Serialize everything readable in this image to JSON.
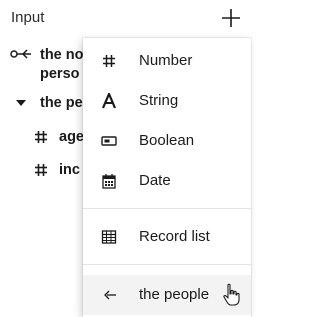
{
  "panel": {
    "title": "Input",
    "add_icon": "plus-icon"
  },
  "tree": {
    "items": [
      {
        "icon": "link-key-icon",
        "label_line1": "the no",
        "label_line2": "perso"
      },
      {
        "icon": "caret-down-icon",
        "label": "the pe"
      },
      {
        "icon": "hash-icon",
        "label": "age"
      },
      {
        "icon": "hash-icon",
        "label": "inc"
      }
    ]
  },
  "menu": {
    "items": [
      {
        "icon": "hash-icon",
        "label": "Number"
      },
      {
        "icon": "text-a-icon",
        "label": "String"
      },
      {
        "icon": "toggle-icon",
        "label": "Boolean"
      },
      {
        "icon": "calendar-icon",
        "label": "Date"
      },
      {
        "icon": "table-icon",
        "label": "Record list"
      },
      {
        "icon": "link-key-icon",
        "label": "the people"
      }
    ]
  },
  "colors": {
    "menu_hover": "#f3f3f3",
    "text": "#1b1b1b"
  }
}
